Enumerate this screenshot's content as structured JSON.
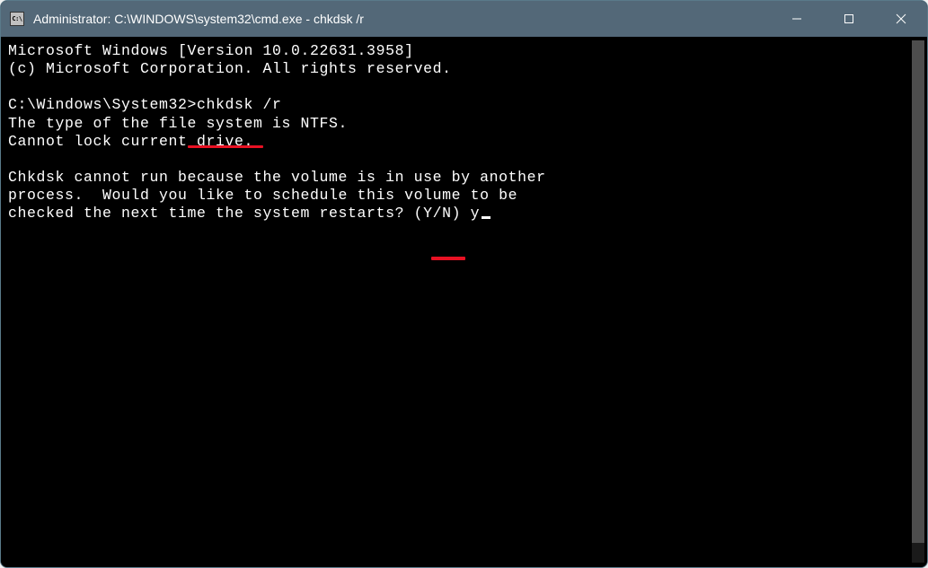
{
  "titlebar": {
    "icon_text": "C:\\",
    "title": "Administrator: C:\\WINDOWS\\system32\\cmd.exe - chkdsk  /r"
  },
  "terminal": {
    "line1": "Microsoft Windows [Version 10.0.22631.3958]",
    "line2": "(c) Microsoft Corporation. All rights reserved.",
    "line3": "",
    "prompt": "C:\\Windows\\System32>",
    "command": "chkdsk /r",
    "line5": "The type of the file system is NTFS.",
    "line6": "Cannot lock current drive.",
    "line7": "",
    "line8": "Chkdsk cannot run because the volume is in use by another",
    "line9": "process.  Would you like to schedule this volume to be",
    "line10_prefix": "checked the next time the system restarts? (Y/N) ",
    "user_input": "y"
  }
}
